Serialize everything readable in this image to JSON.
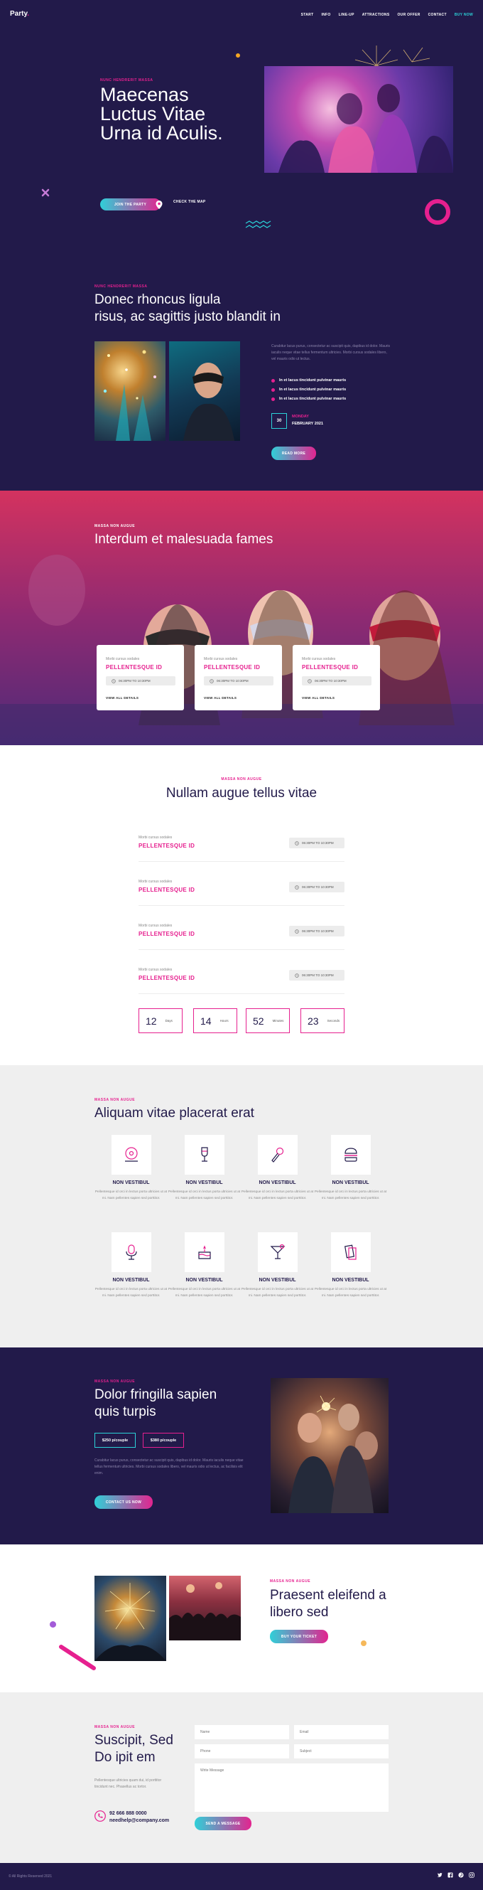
{
  "header": {
    "logo": "Party",
    "logo_dot": ".",
    "nav": [
      "START",
      "INFO",
      "LINE-UP",
      "ATTRACTIONS",
      "OUR OFFER",
      "CONTACT"
    ],
    "buy_now": "BUY NOW"
  },
  "hero": {
    "kicker": "NUNC HENDRERIT MASSA",
    "title": "Maecenas Luctus Vitae Urna id Aculis.",
    "cta": "JOIN THE PARTY",
    "map_link": "CHECK THE MAP"
  },
  "about": {
    "kicker": "NUNC HENDRERIT MASSA",
    "title_line1": "Donec rhoncus ligula",
    "title_line2": "risus, ac sagittis justo blandit in",
    "paragraph": "Curabitur lacus purus, consectetur ac suscipit quis, dapibus id dolor. Mauris iaculis neque vitae tellus fermentum ultricies. Morbi cursus sodales libero, vel mauris odio ut lectus.",
    "bullets": [
      "In et lacus tincidunt pulvinar mauris",
      "In et lacus tincidunt pulvinar mauris",
      "In et lacus tincidunt pulvinar mauris"
    ],
    "date_day": "30",
    "date_weekday": "MONDAY",
    "date_month": "FEBRUARY 2021",
    "cta": "READ MORE"
  },
  "band": {
    "kicker": "MASSA NON AUGUE",
    "title": "Interdum et malesuada fames",
    "cards": [
      {
        "small": "Morbi cursus sodales",
        "name": "PELLENTESQUE ID",
        "time": "06:30PM TO 10:30PM",
        "more": "VIEW ALL DETAILS"
      },
      {
        "small": "Morbi cursus sodales",
        "name": "PELLENTESQUE ID",
        "time": "06:30PM TO 10:30PM",
        "more": "VIEW ALL DETAILS"
      },
      {
        "small": "Morbi cursus sodales",
        "name": "PELLENTESQUE ID",
        "time": "06:30PM TO 10:30PM",
        "more": "VIEW ALL DETAILS"
      }
    ]
  },
  "schedule": {
    "kicker": "MASSA NON AUGUE",
    "title": "Nullam augue tellus vitae",
    "rows": [
      {
        "small": "Morbi cursus sodales",
        "name": "PELLENTESQUE ID",
        "time": "06:30PM TO 10:30PM"
      },
      {
        "small": "Morbi cursus sodales",
        "name": "PELLENTESQUE ID",
        "time": "06:30PM TO 10:30PM"
      },
      {
        "small": "Morbi cursus sodales",
        "name": "PELLENTESQUE ID",
        "time": "06:30PM TO 10:30PM"
      },
      {
        "small": "Morbi cursus sodales",
        "name": "PELLENTESQUE ID",
        "time": "06:30PM TO 10:30PM"
      }
    ],
    "countdown": [
      {
        "value": "12",
        "unit": "Days"
      },
      {
        "value": "14",
        "unit": "Hours"
      },
      {
        "value": "52",
        "unit": "Minutes"
      },
      {
        "value": "23",
        "unit": "Seconds"
      }
    ]
  },
  "services": {
    "kicker": "MASSA NON AUGUE",
    "title": "Aliquam vitae placerat erat",
    "items": [
      {
        "icon": "vinyl-record-icon",
        "title": "NON VESTIBUL",
        "desc": "Pellentesque id orci in lectus porta ultricies ut at mi. Nam pellentes sapien sed porttitor."
      },
      {
        "icon": "wine-glass-icon",
        "title": "NON VESTIBUL",
        "desc": "Pellentesque id orci in lectus porta ultricies ut at mi. Nam pellentes sapien sed porttitor."
      },
      {
        "icon": "microphone-icon",
        "title": "NON VESTIBUL",
        "desc": "Pellentesque id orci in lectus porta ultricies ut at mi. Nam pellentes sapien sed porttitor."
      },
      {
        "icon": "burger-icon",
        "title": "NON VESTIBUL",
        "desc": "Pellentesque id orci in lectus porta ultricies ut at mi. Nam pellentes sapien sed porttitor."
      },
      {
        "icon": "studio-mic-icon",
        "title": "NON VESTIBUL",
        "desc": "Pellentesque id orci in lectus porta ultricies ut at mi. Nam pellentes sapien sed porttitor."
      },
      {
        "icon": "cake-icon",
        "title": "NON VESTIBUL",
        "desc": "Pellentesque id orci in lectus porta ultricies ut at mi. Nam pellentes sapien sed porttitor."
      },
      {
        "icon": "cocktail-icon",
        "title": "NON VESTIBUL",
        "desc": "Pellentesque id orci in lectus porta ultricies ut at mi. Nam pellentes sapien sed porttitor."
      },
      {
        "icon": "tickets-icon",
        "title": "NON VESTIBUL",
        "desc": "Pellentesque id orci in lectus porta ultricies ut at mi. Nam pellentes sapien sed porttitor."
      }
    ]
  },
  "pricing": {
    "kicker": "MASSA NON AUGUE",
    "title_line1": "Dolor fringilla sapien",
    "title_line2": "quis turpis",
    "price1": "$250 p/couple",
    "price2": "$380 p/couple",
    "paragraph": "Curabitur lacus purus, consectetur ac suscipit quis, dapibus id dolor. Mauris iaculis neque vitae tellus fermentum ultricies. Morbi cursus sodales libero, vel mauris odio ut lectus, ac facilisis elit enim.",
    "cta": "CONTACT US NOW"
  },
  "gallery": {
    "kicker": "MASSA NON AUGUE",
    "title_line1": "Praesent eleifend a",
    "title_line2": "libero sed",
    "cta": "BUY YOUR TICKET"
  },
  "contact": {
    "kicker": "MASSA NON AUGUE",
    "title_line1": "Suscipit, Sed",
    "title_line2": "Do ipit em",
    "paragraph": "Pellentesque ultricies quam dui, id porttitor tincidunt nec. Phasellus ac tortor.",
    "phone": "92 666 888 0000",
    "email": "needhelp@company.com",
    "fields": {
      "name": "Name",
      "email": "Email",
      "phone": "Phone",
      "subject": "Subject",
      "message": "Write Message"
    },
    "cta": "SEND A MESSAGE"
  },
  "footer": {
    "copyright": "© All Rights Reserved 2021",
    "socials": [
      "twitter-icon",
      "facebook-icon",
      "pinterest-icon",
      "instagram-icon"
    ]
  },
  "colors": {
    "navy": "#221a4a",
    "pink": "#e6208f",
    "cyan": "#2cd3d9",
    "light": "#efefef"
  }
}
